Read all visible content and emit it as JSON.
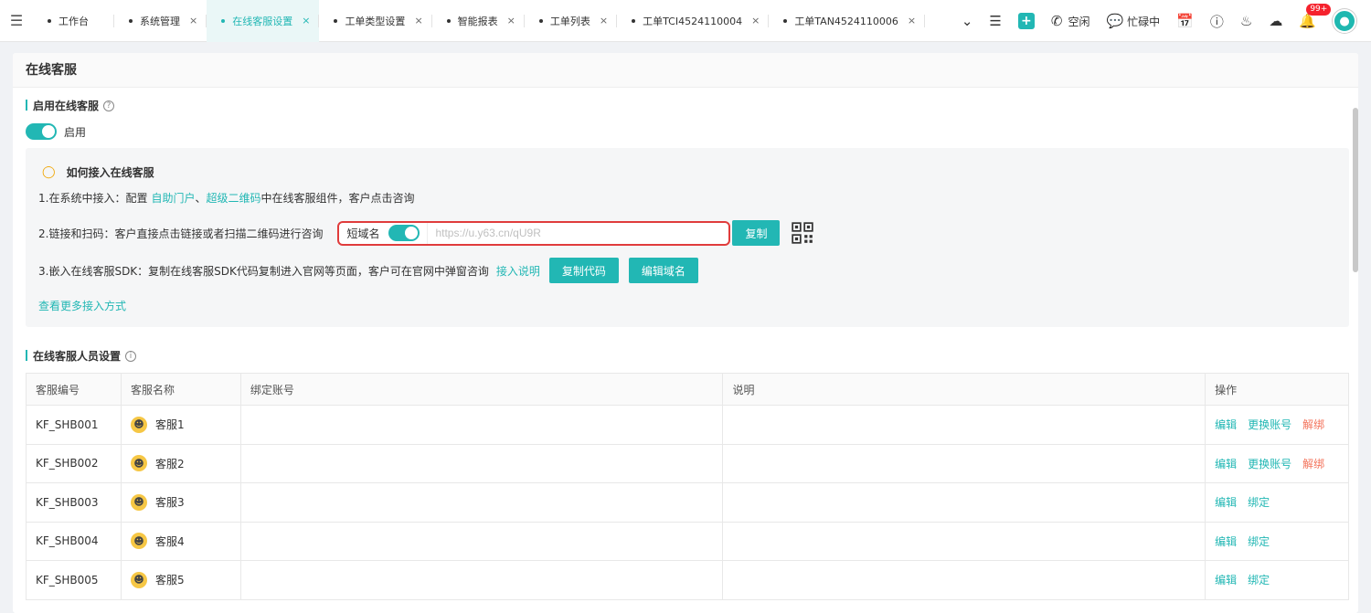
{
  "topbar": {
    "tabs": [
      {
        "label": "工作台",
        "active": false,
        "closable": false
      },
      {
        "label": "系统管理",
        "active": false,
        "closable": true
      },
      {
        "label": "在线客服设置",
        "active": true,
        "closable": true
      },
      {
        "label": "工单类型设置",
        "active": false,
        "closable": true
      },
      {
        "label": "智能报表",
        "active": false,
        "closable": true
      },
      {
        "label": "工单列表",
        "active": false,
        "closable": true
      },
      {
        "label": "工单TCI4524110004",
        "active": false,
        "closable": true
      },
      {
        "label": "工单TAN4524110006",
        "active": false,
        "closable": true
      }
    ],
    "status_idle": "空闲",
    "status_busy": "忙碌中",
    "notification_count": "99+",
    "accent_color": "#22b7b4"
  },
  "page": {
    "title": "在线客服"
  },
  "enable_section": {
    "title": "启用在线客服",
    "switch_label": "启用",
    "enabled": true
  },
  "guide": {
    "title": "如何接入在线客服",
    "line1_prefix": "1.在系统中接入：配置",
    "line1_link1": "自助门户",
    "line1_sep": "、",
    "line1_link2": "超级二维码",
    "line1_suffix": "中在线客服组件，客户点击咨询",
    "line2_text": "2.链接和扫码：客户直接点击链接或者扫描二维码进行咨询",
    "short_domain_label": "短域名",
    "short_domain_enabled": true,
    "link_value": "https://u.y63.cn/qU9R",
    "copy_button": "复制",
    "line3_text": "3.嵌入在线客服SDK：复制在线客服SDK代码复制进入官网等页面，客户可在官网中弹窗咨询",
    "line3_link": "接入说明",
    "copy_code_button": "复制代码",
    "edit_domain_button": "编辑域名",
    "more_link": "查看更多接入方式"
  },
  "agents_section": {
    "title": "在线客服人员设置",
    "columns": [
      "客服编号",
      "客服名称",
      "绑定账号",
      "说明",
      "操作"
    ],
    "rows": [
      {
        "id": "KF_SHB001",
        "name": "客服1",
        "account": "",
        "note": "",
        "actions": [
          "编辑",
          "更换账号",
          "解绑"
        ]
      },
      {
        "id": "KF_SHB002",
        "name": "客服2",
        "account": "",
        "note": "",
        "actions": [
          "编辑",
          "更换账号",
          "解绑"
        ]
      },
      {
        "id": "KF_SHB003",
        "name": "客服3",
        "account": "",
        "note": "",
        "actions": [
          "编辑",
          "绑定"
        ]
      },
      {
        "id": "KF_SHB004",
        "name": "客服4",
        "account": "",
        "note": "",
        "actions": [
          "编辑",
          "绑定"
        ]
      },
      {
        "id": "KF_SHB005",
        "name": "客服5",
        "account": "",
        "note": "",
        "actions": [
          "编辑",
          "绑定"
        ]
      }
    ]
  }
}
